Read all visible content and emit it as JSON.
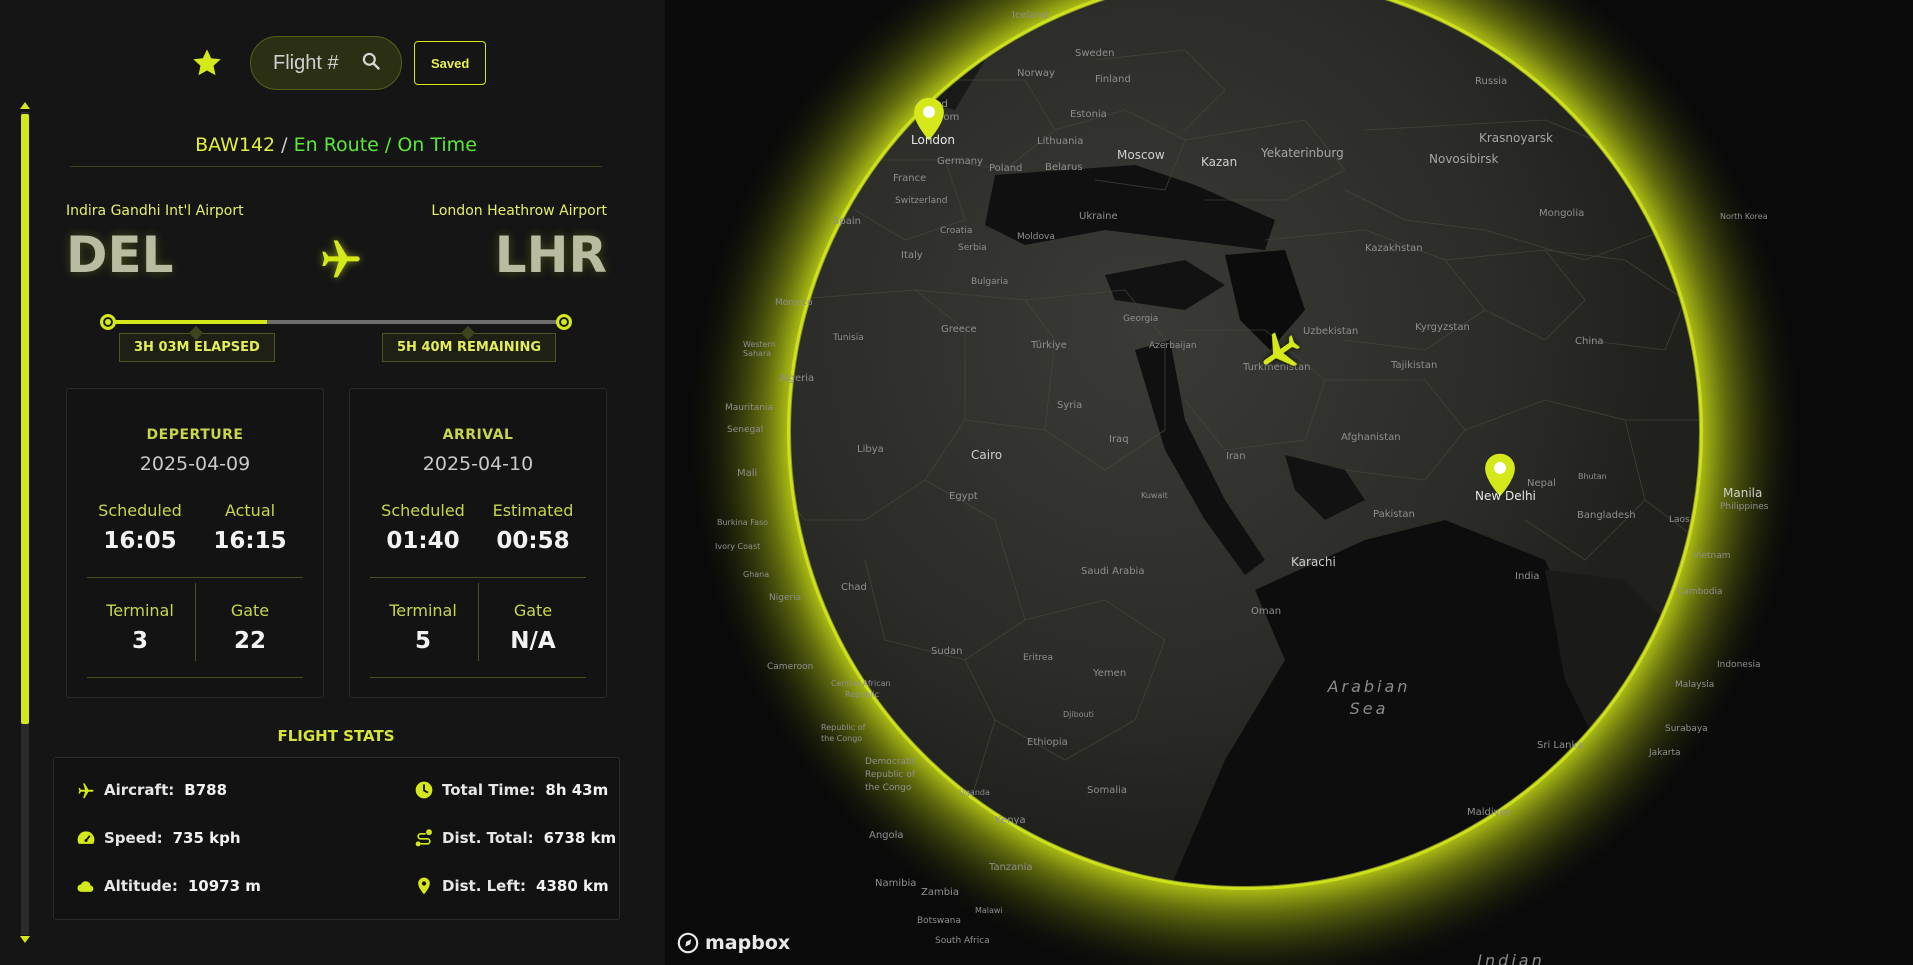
{
  "sidebar": {
    "search": {
      "placeholder": "Flight #"
    },
    "saved_label": "Saved",
    "flight": {
      "code": "BAW142",
      "separator": " / ",
      "status": "En Route / On Time"
    },
    "origin": {
      "name": "Indira Gandhi Int'l Airport",
      "iata": "DEL"
    },
    "destination": {
      "name": "London Heathrow Airport",
      "iata": "LHR"
    },
    "progress": {
      "elapsed_fraction": 0.35,
      "elapsed_label": "3H 03M ELAPSED",
      "remaining_label": "5H 40M REMAINING"
    },
    "departure": {
      "title": "DEPERTURE",
      "date": "2025-04-09",
      "scheduled_label": "Scheduled",
      "scheduled": "16:05",
      "actual_label": "Actual",
      "actual": "16:15",
      "terminal_label": "Terminal",
      "terminal": "3",
      "gate_label": "Gate",
      "gate": "22"
    },
    "arrival": {
      "title": "ARRIVAL",
      "date": "2025-04-10",
      "scheduled_label": "Scheduled",
      "scheduled": "01:40",
      "estimated_label": "Estimated",
      "estimated": "00:58",
      "terminal_label": "Terminal",
      "terminal": "5",
      "gate_label": "Gate",
      "gate": "N/A"
    },
    "stats": {
      "title": "FLIGHT STATS",
      "aircraft": {
        "label": "Aircraft:",
        "value": "B788"
      },
      "speed": {
        "label": "Speed:",
        "value": "735 kph"
      },
      "altitude": {
        "label": "Altitude:",
        "value": "10973 m"
      },
      "total_time": {
        "label": "Total Time:",
        "value": "8h 43m"
      },
      "dist_total": {
        "label": "Dist. Total:",
        "value": "6738 km"
      },
      "dist_left": {
        "label": "Dist. Left:",
        "value": "4380 km"
      }
    }
  },
  "map": {
    "accent_color": "#d4e81a",
    "attribution": "mapbox",
    "markers": {
      "origin": "New Delhi",
      "destination": "London"
    },
    "labels": {
      "iceland": "Iceland",
      "sweden": "Sweden",
      "norway": "Norway",
      "finland": "Finland",
      "russia": "Russia",
      "estonia": "Estonia",
      "london": "London",
      "uk_frag1": "United",
      "uk_frag2": "Kingdom",
      "lithuania": "Lithuania",
      "moscow": "Moscow",
      "kazan": "Kazan",
      "yekaterinburg": "Yekaterinburg",
      "krasnoyarsk": "Krasnoyarsk",
      "novosibirsk": "Novosibirsk",
      "germany": "Germany",
      "poland": "Poland",
      "belarus": "Belarus",
      "france": "France",
      "switzerland": "Switzerland",
      "ukraine": "Ukraine",
      "moldova": "Moldova",
      "spain": "Spain",
      "croatia": "Croatia",
      "serbia": "Serbia",
      "italy": "Italy",
      "bulgaria": "Bulgaria",
      "kazakhstan": "Kazakhstan",
      "mongolia": "Mongolia",
      "north_korea": "North Korea",
      "morocco": "Morocco",
      "greece": "Greece",
      "georgia": "Georgia",
      "uzbekistan": "Uzbekistan",
      "kyrgyzstan": "Kyrgyzstan",
      "china": "China",
      "tunisia": "Tunisia",
      "turkiye": "Türkiye",
      "azerbaijan": "Azerbaijan",
      "turkmenistan": "Turkmenistan",
      "tajikistan": "Tajikistan",
      "western_sahara": "Western Sahara",
      "algeria": "Algeria",
      "syria": "Syria",
      "mauritania": "Mauritania",
      "senegal": "Senegal",
      "libya": "Libya",
      "iraq": "Iraq",
      "cairo": "Cairo",
      "afghanistan": "Afghanistan",
      "nepal": "Nepal",
      "mali": "Mali",
      "iran": "Iran",
      "bhutan": "Bhutan",
      "manila": "Manila",
      "philippines": "Philippines",
      "egypt": "Egypt",
      "kuwait": "Kuwait",
      "pakistan": "Pakistan",
      "bangladesh": "Bangladesh",
      "burkina_faso": "Burkina Faso",
      "ivory_coast": "Ivory Coast",
      "laos": "Laos",
      "karachi": "Karachi",
      "vietnam": "Vietnam",
      "ghana": "Ghana",
      "saudi_arabia": "Saudi Arabia",
      "india": "India",
      "chad": "Chad",
      "nigeria": "Nigeria",
      "cambodia": "Cambodia",
      "oman": "Oman",
      "sudan": "Sudan",
      "eritrea": "Eritrea",
      "yemen": "Yemen",
      "cameroon": "Cameroon",
      "arabian_sea_1": "Arabian",
      "arabian_sea_2": "Sea",
      "car_1": "Central African",
      "car_2": "Republic",
      "malaysia": "Malaysia",
      "indonesia": "Indonesia",
      "djibouti": "Djibouti",
      "roc_1": "Republic of",
      "roc_2": "the Congo",
      "ethiopia": "Ethiopia",
      "sri_lanka": "Sri Lanka",
      "surabaya": "Surabaya",
      "jakarta": "Jakarta",
      "drc_1": "Democratic",
      "drc_2": "Republic of",
      "drc_3": "the Congo",
      "somalia": "Somalia",
      "uganda": "Uganda",
      "maldives": "Maldives",
      "kenya": "Kenya",
      "angola": "Angola",
      "tanzania": "Tanzania",
      "namibia": "Namibia",
      "zambia": "Zambia",
      "malawi": "Malawi",
      "botswana": "Botswana",
      "south_africa": "South Africa",
      "indian_ocean": "Indian"
    }
  }
}
